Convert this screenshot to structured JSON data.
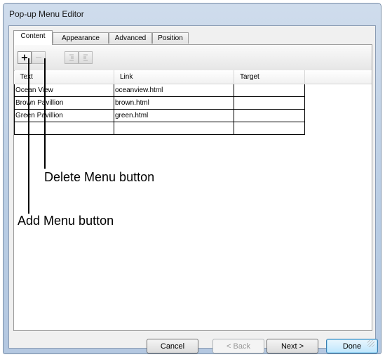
{
  "window": {
    "title": "Pop-up Menu Editor"
  },
  "tabs": [
    {
      "label": "Content",
      "active": true
    },
    {
      "label": "Appearance",
      "active": false
    },
    {
      "label": "Advanced",
      "active": false
    },
    {
      "label": "Position",
      "active": false
    }
  ],
  "toolbar": {
    "add_label": "+",
    "delete_label": "—",
    "indent_icon": "indent-icon",
    "outdent_icon": "outdent-icon"
  },
  "table": {
    "columns": [
      "Text",
      "Link",
      "Target"
    ],
    "rows": [
      [
        "Ocean View",
        "oceanview.html",
        ""
      ],
      [
        "Brown Pavillion",
        "brown.html",
        ""
      ],
      [
        "Green Pavillion",
        "green.html",
        ""
      ],
      [
        "",
        "",
        ""
      ]
    ]
  },
  "callouts": {
    "delete": "Delete Menu button",
    "add": "Add Menu button"
  },
  "buttons": {
    "cancel": "Cancel",
    "back": "< Back",
    "next": "Next >",
    "done": "Done"
  }
}
